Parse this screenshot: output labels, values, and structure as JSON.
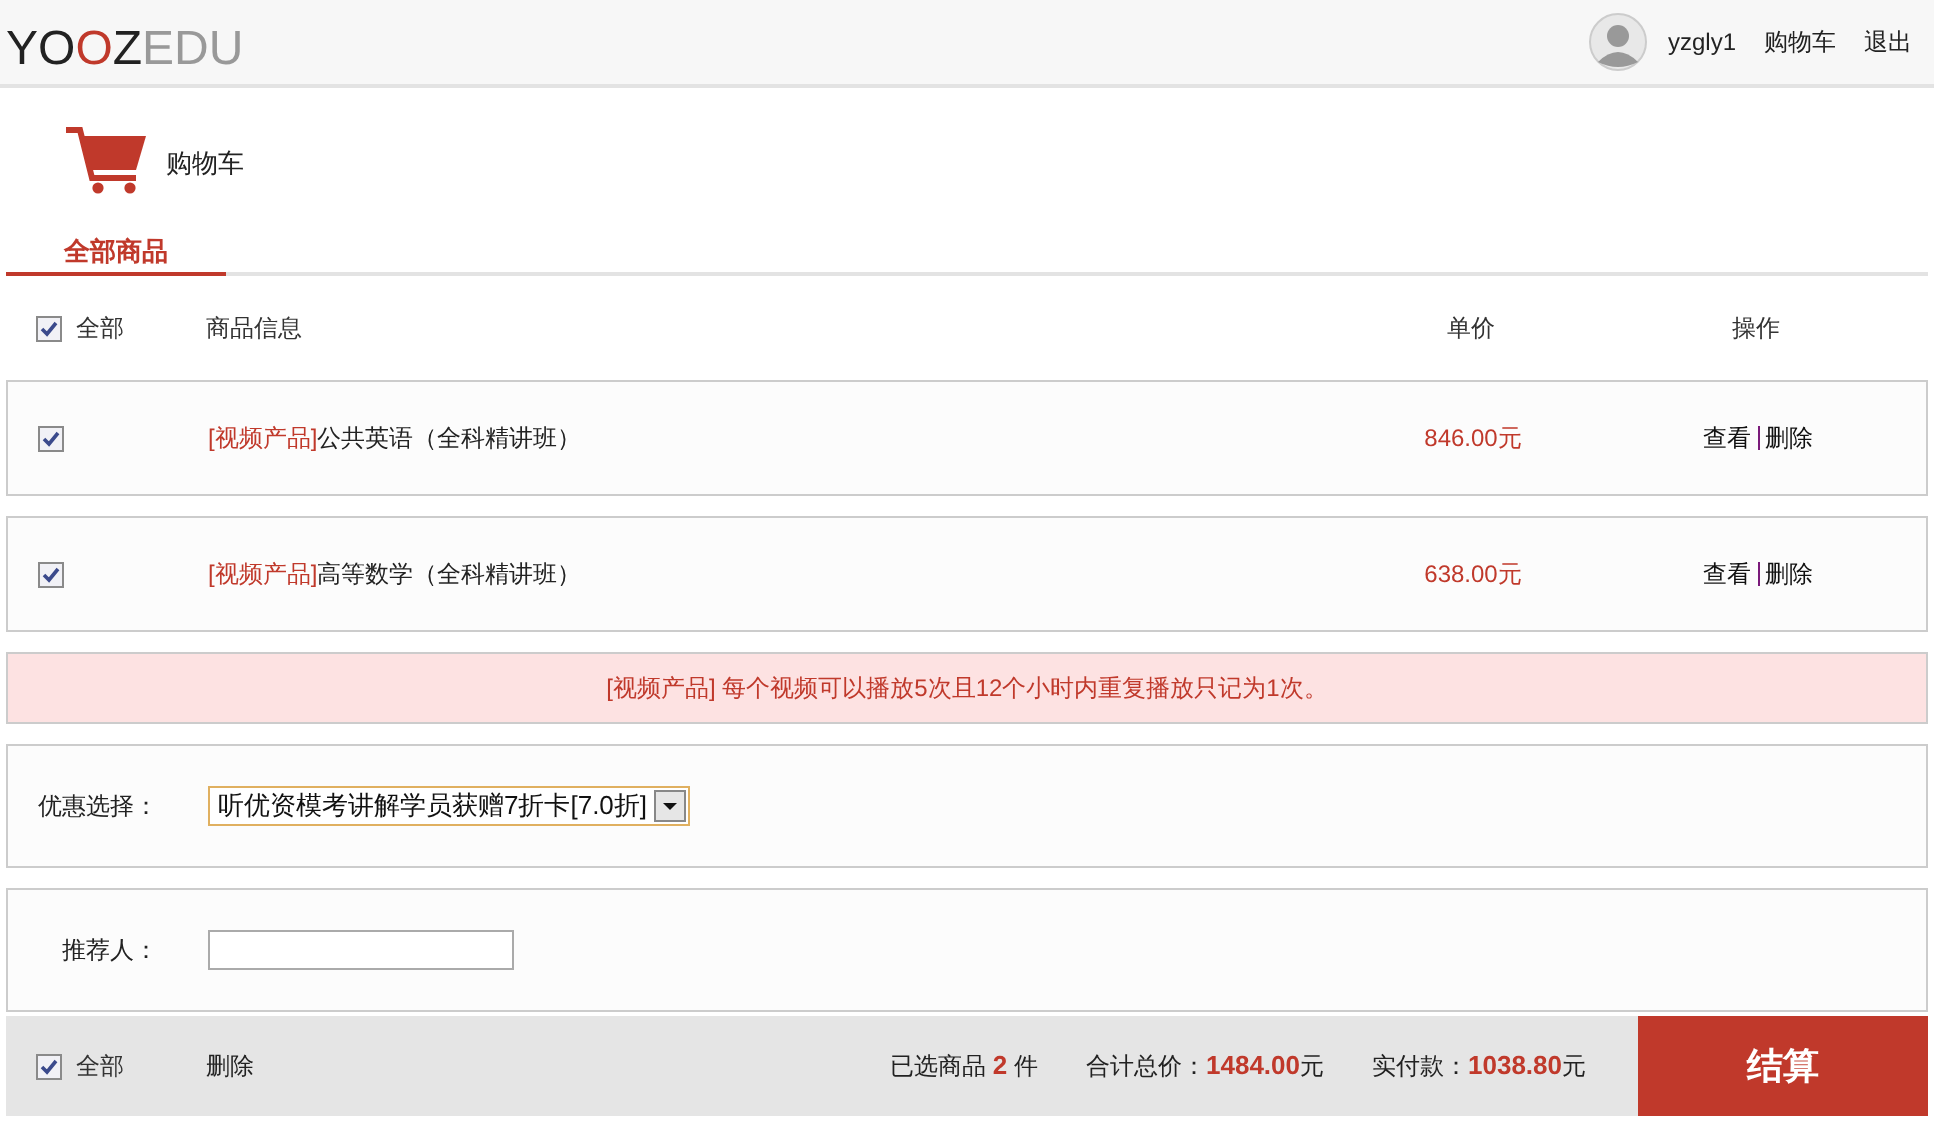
{
  "logo": [
    "YO",
    "O",
    "Z",
    "EDU"
  ],
  "user": {
    "name": "yzgly1",
    "links": [
      "购物车",
      "退出"
    ]
  },
  "page_title": "购物车",
  "tabs": [
    {
      "label": "全部商品",
      "selected": true
    }
  ],
  "table": {
    "select_all": {
      "label": "全部",
      "checked": true
    },
    "columns": [
      "商品信息",
      "单价",
      "操作"
    ],
    "rows": [
      {
        "checked": true,
        "tag": "[视频产品]",
        "name": "公共英语（全科精讲班）",
        "price": "846.00元",
        "actions": [
          "查看",
          "删除"
        ]
      },
      {
        "checked": true,
        "tag": "[视频产品]",
        "name": "高等数学（全科精讲班）",
        "price": "638.00元",
        "actions": [
          "查看",
          "删除"
        ]
      }
    ]
  },
  "notice": {
    "tag": "[视频产品]",
    "text": "每个视频可以播放5次且12个小时内重复播放只记为1次。"
  },
  "discount": {
    "label": "优惠选择：",
    "value": "听优资模考讲解学员获赠7折卡[7.0折]"
  },
  "referrer": {
    "label": "推荐人："
  },
  "footer": {
    "select_all": {
      "label": "全部",
      "checked": true
    },
    "delete": "删除",
    "selected_count": "已选商品 **2** 件",
    "total": "合计总价：**1484.00**元",
    "pay": "实付款：**1038.80**元",
    "checkout": "结算"
  }
}
